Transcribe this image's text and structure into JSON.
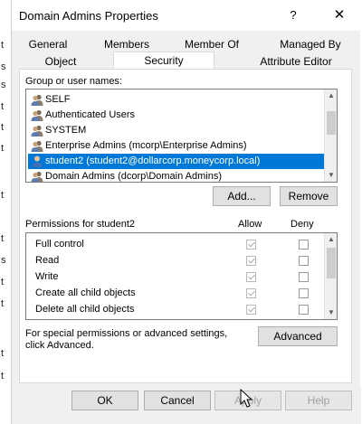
{
  "window": {
    "title": "Domain Admins Properties",
    "help_glyph": "?",
    "close_glyph": "✕"
  },
  "tabs": {
    "row1": [
      "General",
      "Members",
      "Member Of",
      "Managed By"
    ],
    "row2": [
      "Object",
      "Security",
      "Attribute Editor"
    ],
    "active": "Security"
  },
  "groups_label": "Group or user names:",
  "users": [
    {
      "name": "SELF",
      "icon": "users-group-icon"
    },
    {
      "name": "Authenticated Users",
      "icon": "users-group-icon"
    },
    {
      "name": "SYSTEM",
      "icon": "users-group-icon"
    },
    {
      "name": "Enterprise Admins (mcorp\\Enterprise Admins)",
      "icon": "users-group-icon"
    },
    {
      "name": "student2 (student2@dollarcorp.moneycorp.local)",
      "icon": "single-user-icon",
      "selected": true
    },
    {
      "name": "Domain Admins (dcorp\\Domain Admins)",
      "icon": "users-group-icon"
    }
  ],
  "buttons": {
    "add": "Add...",
    "remove": "Remove",
    "advanced": "Advanced",
    "ok": "OK",
    "cancel": "Cancel",
    "apply": "Apply",
    "help": "Help"
  },
  "permissions": {
    "label": "Permissions for student2",
    "allow_header": "Allow",
    "deny_header": "Deny",
    "rows": [
      {
        "name": "Full control",
        "allow": true,
        "deny": false
      },
      {
        "name": "Read",
        "allow": true,
        "deny": false
      },
      {
        "name": "Write",
        "allow": true,
        "deny": false
      },
      {
        "name": "Create all child objects",
        "allow": true,
        "deny": false
      },
      {
        "name": "Delete all child objects",
        "allow": true,
        "deny": false
      }
    ]
  },
  "advanced_text": "For special permissions or advanced settings, click Advanced.",
  "background_text": [
    "t",
    "s",
    "s",
    "t",
    "t",
    "t",
    "t",
    "t",
    "s",
    "t",
    "t",
    "t",
    "t"
  ],
  "colors": {
    "selection": "#0078d7",
    "dialog_bg": "#f0f0f0"
  }
}
